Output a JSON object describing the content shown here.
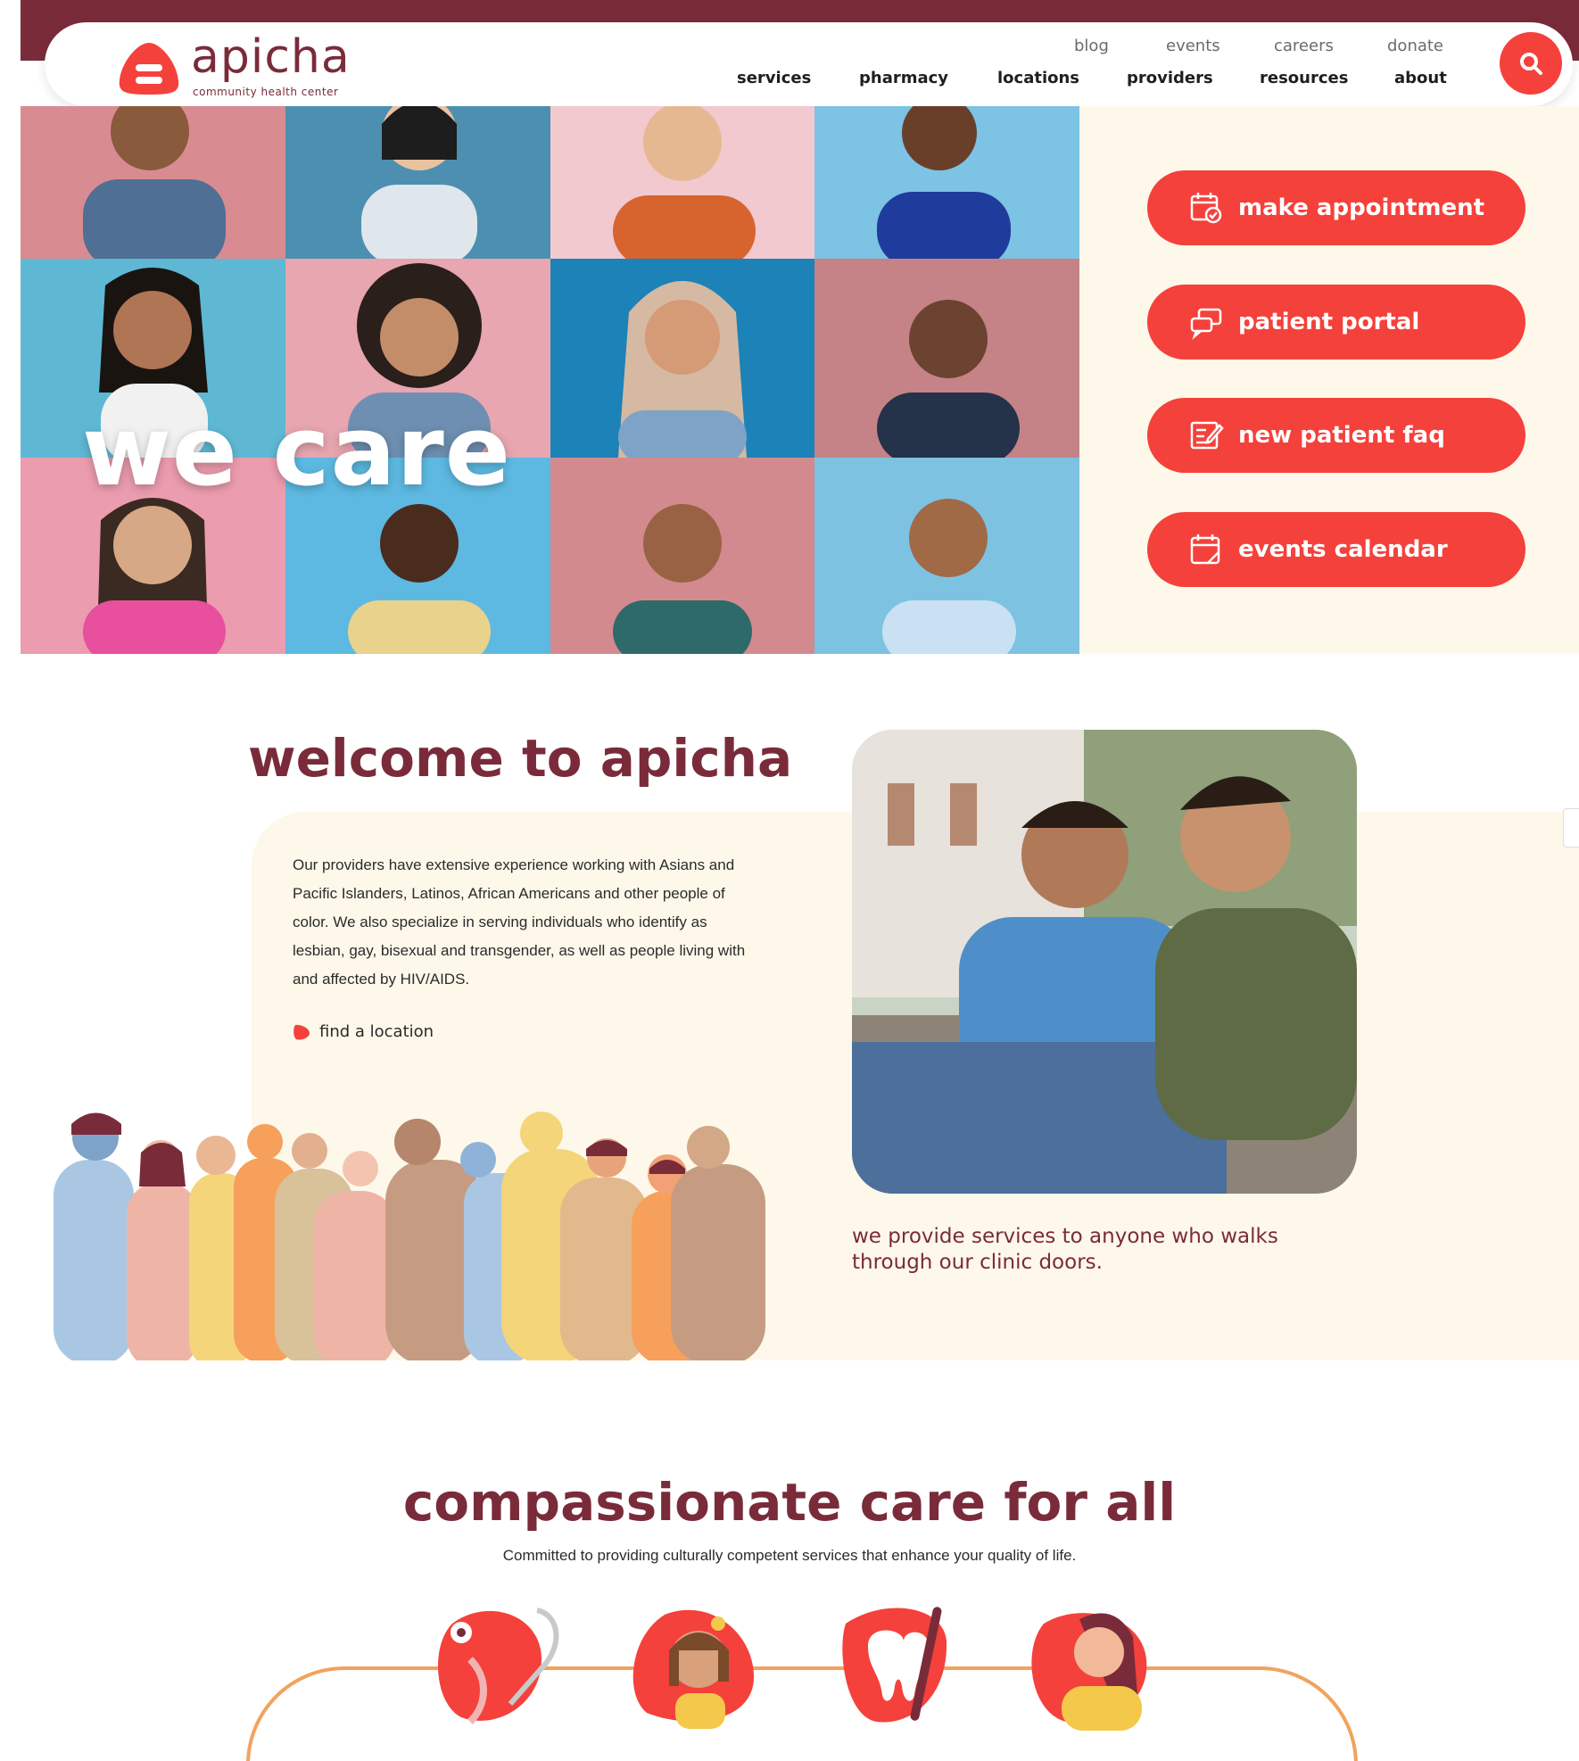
{
  "brand": {
    "name": "apicha",
    "tagline": "community health center"
  },
  "nav": {
    "utility": [
      "blog",
      "events",
      "careers",
      "donate"
    ],
    "main": [
      "services",
      "pharmacy",
      "locations",
      "providers",
      "resources",
      "about"
    ]
  },
  "hero": {
    "headline": "we care",
    "actions": [
      {
        "label": "make appointment",
        "icon": "calendar-check-icon"
      },
      {
        "label": "patient portal",
        "icon": "chat-bubbles-icon"
      },
      {
        "label": "new patient faq",
        "icon": "form-edit-icon"
      },
      {
        "label": "events calendar",
        "icon": "calendar-icon"
      }
    ]
  },
  "welcome": {
    "title": "welcome to apicha",
    "body": "Our providers have extensive experience working with Asians and Pacific Islanders, Latinos, African Americans and other people of color. We also specialize in serving individuals who identify as lesbian, gay, bisexual and transgender, as well as people living with and affected by HIV/AIDS.",
    "link": "find a location",
    "caption": "we provide services to anyone who walks through our clinic doors."
  },
  "compassion": {
    "title": "compassionate care for all",
    "subtitle": "Committed to providing culturally competent services that enhance your quality of life.",
    "service_icons": [
      "stethoscope-icon",
      "child-icon",
      "tooth-icon",
      "woman-icon"
    ]
  },
  "colors": {
    "brand_maroon": "#7a2b3a",
    "accent_red": "#f5413b",
    "cream": "#fdf8ea",
    "line_orange": "#f1a35e"
  }
}
